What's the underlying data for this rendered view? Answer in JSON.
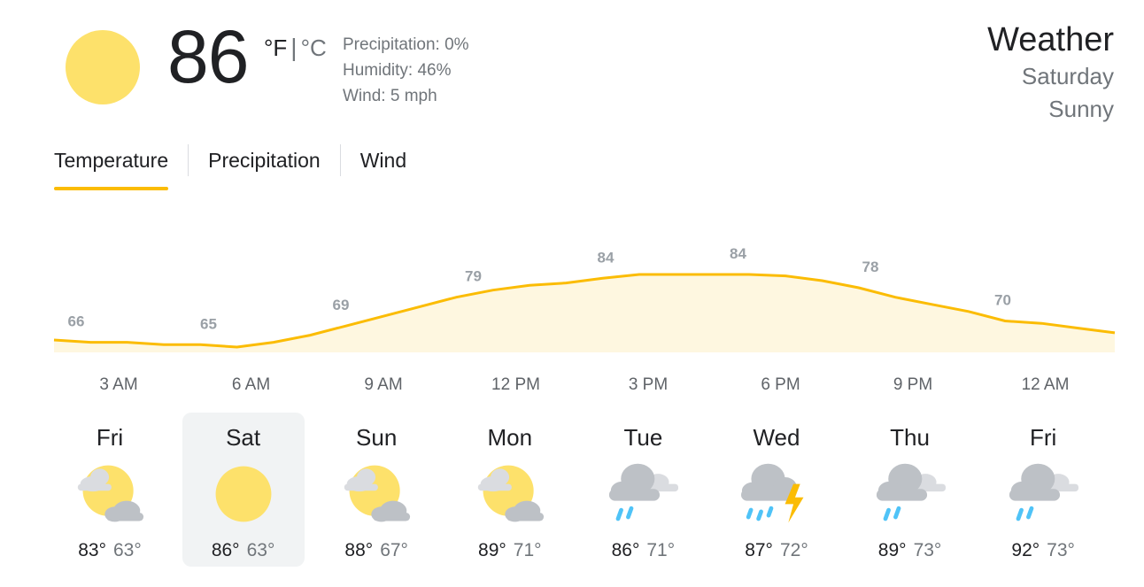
{
  "current": {
    "temperature": "86",
    "unit_f": "°F",
    "unit_c": "°C",
    "precipitation": "Precipitation: 0%",
    "humidity": "Humidity: 46%",
    "wind": "Wind: 5 mph",
    "icon": "sun-icon"
  },
  "header": {
    "title": "Weather",
    "day": "Saturday",
    "condition": "Sunny"
  },
  "tabs": [
    {
      "label": "Temperature",
      "active": true
    },
    {
      "label": "Precipitation",
      "active": false
    },
    {
      "label": "Wind",
      "active": false
    }
  ],
  "chart_data": {
    "type": "area",
    "labels": [
      "66",
      "65",
      "69",
      "79",
      "84",
      "84",
      "78",
      "70"
    ],
    "x_labels": [
      "3 AM",
      "6 AM",
      "9 AM",
      "12 PM",
      "3 PM",
      "6 PM",
      "9 PM",
      "12 AM"
    ],
    "series": [
      {
        "values": [
          66.5,
          66,
          66,
          65.5,
          65.5,
          65,
          66,
          67.5,
          69.5,
          71.5,
          73.5,
          75.5,
          77,
          78,
          78.5,
          79.5,
          80.3,
          80.3,
          80.3,
          80.3,
          80,
          79,
          77.5,
          75.5,
          74,
          72.5,
          70.5,
          70,
          69,
          68
        ]
      }
    ],
    "colors": {
      "line": "#fbbc04",
      "fill": "#fef7e0",
      "label": "#9aa0a6"
    }
  },
  "forecast": [
    {
      "day": "Fri",
      "hi": "83°",
      "lo": "63°",
      "icon": "partly-cloudy-icon",
      "selected": false
    },
    {
      "day": "Sat",
      "hi": "86°",
      "lo": "63°",
      "icon": "sun-icon",
      "selected": true
    },
    {
      "day": "Sun",
      "hi": "88°",
      "lo": "67°",
      "icon": "partly-cloudy-icon",
      "selected": false
    },
    {
      "day": "Mon",
      "hi": "89°",
      "lo": "71°",
      "icon": "partly-cloudy-icon",
      "selected": false
    },
    {
      "day": "Tue",
      "hi": "86°",
      "lo": "71°",
      "icon": "rain-cloud-icon",
      "selected": false
    },
    {
      "day": "Wed",
      "hi": "87°",
      "lo": "72°",
      "icon": "thunderstorm-icon",
      "selected": false
    },
    {
      "day": "Thu",
      "hi": "89°",
      "lo": "73°",
      "icon": "rain-cloud-icon",
      "selected": false
    },
    {
      "day": "Fri",
      "hi": "92°",
      "lo": "73°",
      "icon": "rain-cloud-icon",
      "selected": false
    }
  ]
}
